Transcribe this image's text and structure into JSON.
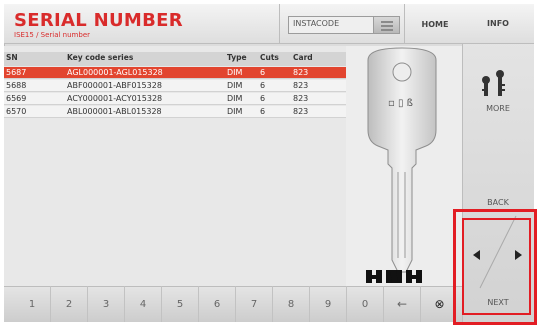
{
  "header": {
    "title": "SERIAL NUMBER",
    "subtitle": "ISE15 / Serial number",
    "insta_label": "INSTACODE",
    "home_label": "HOME",
    "info_label": "INFO"
  },
  "table": {
    "columns": [
      "SN",
      "Key code series",
      "Type",
      "Cuts",
      "Card"
    ],
    "rows": [
      {
        "sn": "5687",
        "series": "AGL000001-AGL015328",
        "type": "DIM",
        "cuts": "6",
        "card": "823",
        "selected": true
      },
      {
        "sn": "5688",
        "series": "ABF000001-ABF015328",
        "type": "DIM",
        "cuts": "6",
        "card": "823",
        "selected": false
      },
      {
        "sn": "6569",
        "series": "ACY000001-ACY015328",
        "type": "DIM",
        "cuts": "6",
        "card": "823",
        "selected": false
      },
      {
        "sn": "6570",
        "series": "ABL000001-ABL015328",
        "type": "DIM",
        "cuts": "6",
        "card": "823",
        "selected": false
      }
    ]
  },
  "key_head_text": "▫ ▯ ß",
  "side": {
    "more_label": "MORE",
    "back_label": "BACK",
    "next_label": "NEXT"
  },
  "keypad": {
    "keys": [
      "1",
      "2",
      "3",
      "4",
      "5",
      "6",
      "7",
      "8",
      "9",
      "0",
      "←",
      "⊗"
    ]
  },
  "colors": {
    "accent": "#d92b2b",
    "selected_row": "#e2452f",
    "highlight": "#e21d24"
  }
}
